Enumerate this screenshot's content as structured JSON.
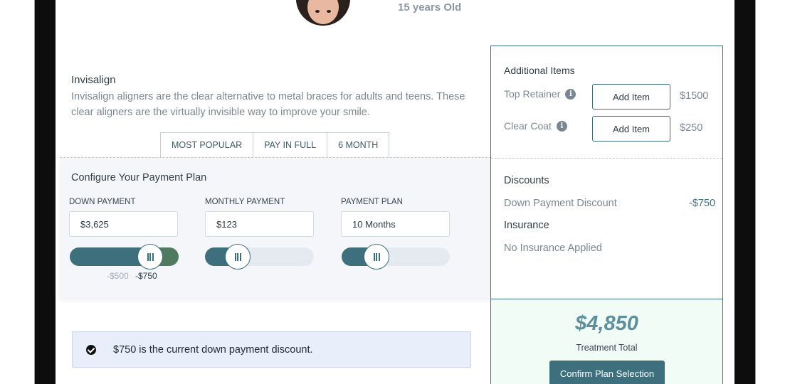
{
  "patient": {
    "age_label": "15 years Old"
  },
  "product": {
    "title": "Invisalign",
    "description": "Invisalign aligners are the clear alternative to metal braces for adults and teens. These clear aligners are the virtually invisible way to improve your smile."
  },
  "tabs": [
    {
      "label": "MOST POPULAR"
    },
    {
      "label": "PAY IN FULL"
    },
    {
      "label": "6 MONTH"
    }
  ],
  "config": {
    "title": "Configure Your Payment Plan",
    "down_payment": {
      "label": "DOWN PAYMENT",
      "value": "$3,625",
      "slider_level": 0.74
    },
    "monthly_payment": {
      "label": "MONTHLY PAYMENT",
      "value": "$123",
      "slider_level": 0.3
    },
    "payment_plan": {
      "label": "PAYMENT PLAN",
      "value": "10 Months",
      "slider_level": 0.32
    },
    "discount_notes": {
      "previous": "-$500",
      "current": "-$750"
    }
  },
  "additional_items": {
    "title": "Additional Items",
    "items": [
      {
        "label": "Top Retainer",
        "button": "Add Item",
        "price": "$1500"
      },
      {
        "label": "Clear Coat",
        "button": "Add Item",
        "price": "$250"
      }
    ]
  },
  "discounts": {
    "title": "Discounts",
    "label": "Down Payment Discount",
    "value": "-$750"
  },
  "insurance": {
    "title": "Insurance",
    "value": "No Insurance Applied"
  },
  "total": {
    "amount": "$4,850",
    "label": "Treatment Total",
    "confirm_label": "Confirm Plan Selection"
  },
  "alert": {
    "text": "$750 is the current down payment discount."
  },
  "colors": {
    "accent": "#3e6f7c",
    "discount_green": "#4f7a5f",
    "total_bg": "#f1fcf7",
    "alert_bg": "#e8eefa"
  }
}
